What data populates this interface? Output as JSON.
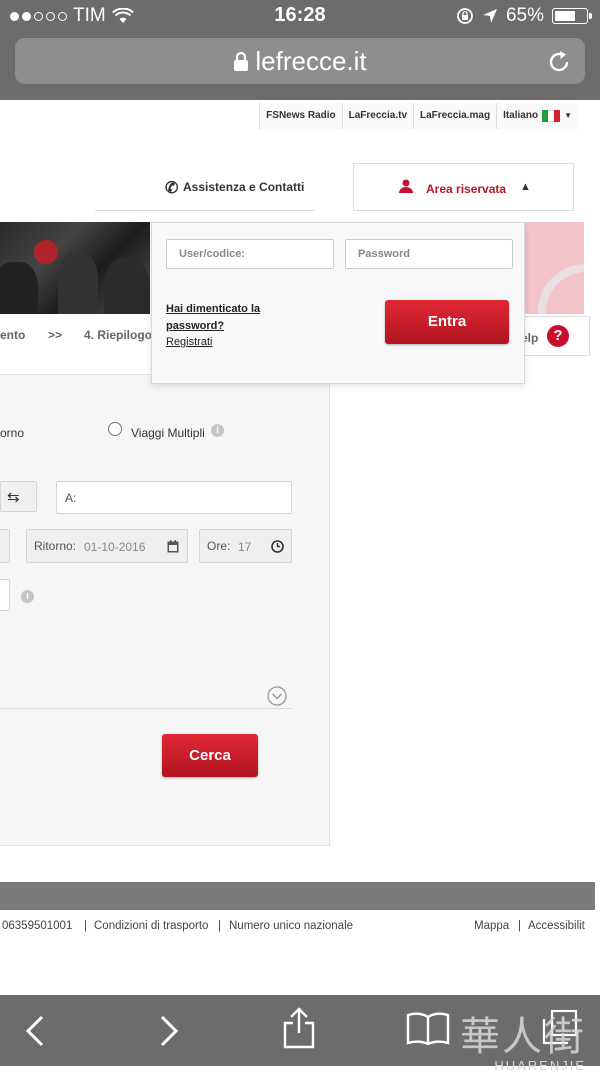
{
  "status": {
    "carrier": "TIM",
    "time": "16:28",
    "battery": "65%"
  },
  "url": {
    "domain": "lefrecce.it"
  },
  "toplinks": {
    "items": [
      "FSNews Radio",
      "LaFreccia.tv",
      "LaFreccia.mag"
    ],
    "language": "Italiano"
  },
  "header": {
    "assistance": "Assistenza e Contatti",
    "reserved_area": "Area riservata"
  },
  "steps": {
    "step_prev": "ento",
    "sep": ">>",
    "step4": "4. Riepilogo",
    "help": "elp"
  },
  "login": {
    "user_placeholder": "User/codice:",
    "password_placeholder": "Password",
    "forgot": "Hai dimenticato la password?",
    "register": "Registrati",
    "enter": "Entra"
  },
  "search": {
    "return_trip_label": "orno",
    "multi_label": "Viaggi Multipli",
    "to_label": "A:",
    "return_label": "Ritorno:",
    "return_date": "01-10-2016",
    "hour_label": "Ore:",
    "hour_value": "17",
    "search_button": "Cerca"
  },
  "footer": {
    "vat": "06359501001",
    "transport": "Condizioni di trasporto",
    "number": "Numero unico nazionale",
    "map": "Mappa",
    "access": "Accessibilit"
  },
  "watermark": {
    "chinese": "華人街",
    "latin": "HUARENJIE"
  },
  "colors": {
    "accent": "#c8102e",
    "chrome": "#6c6c6c"
  }
}
